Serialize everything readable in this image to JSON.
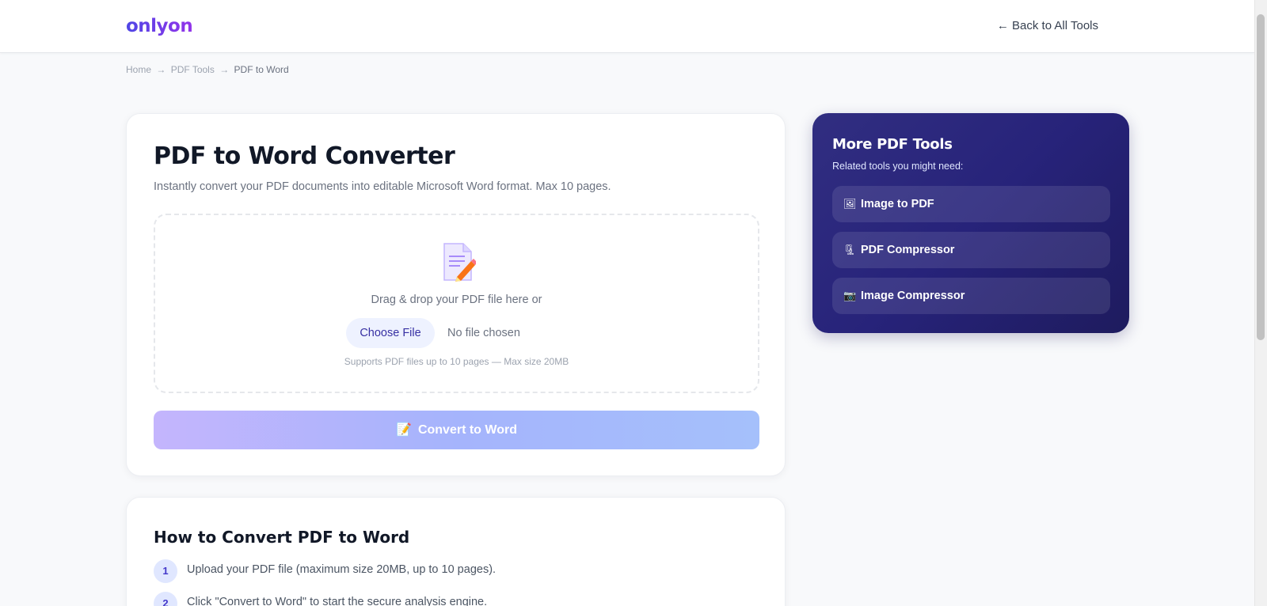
{
  "header": {
    "logo": "onlyon",
    "back_link": "← Back to All Tools"
  },
  "breadcrumb": {
    "items": [
      "Home",
      "PDF Tools",
      "PDF to Word"
    ],
    "separator": "→"
  },
  "converter": {
    "title": "PDF to Word Converter",
    "subtitle": "Instantly convert your PDF documents into editable Microsoft Word format. Max 10 pages.",
    "dropzone": {
      "icon": "document-pencil-icon",
      "prompt": "Drag & drop your PDF file here or",
      "choose_label": "Choose File",
      "file_status": "No file chosen",
      "support_note": "Supports PDF files up to 10 pages — Max size 20MB"
    },
    "convert_button": {
      "icon": "📝",
      "label": "Convert to Word"
    }
  },
  "sidebar": {
    "title": "More PDF Tools",
    "subtitle": "Related tools you might need:",
    "items": [
      {
        "icon": "🖼",
        "label": "Image to PDF"
      },
      {
        "icon": "🗜",
        "label": "PDF Compressor"
      },
      {
        "icon": "📷",
        "label": "Image Compressor"
      }
    ]
  },
  "howto": {
    "title": "How to Convert PDF to Word",
    "steps": [
      {
        "num": "1",
        "text": "Upload your PDF file (maximum size 20MB, up to 10 pages)."
      },
      {
        "num": "2",
        "text": "Click \"Convert to Word\" to start the secure analysis engine."
      }
    ]
  },
  "colors": {
    "brand_start": "#4f46e5",
    "brand_end": "#9333ea",
    "sidebar_bg": "#27237a",
    "convert_button": "#a5b4fc"
  }
}
